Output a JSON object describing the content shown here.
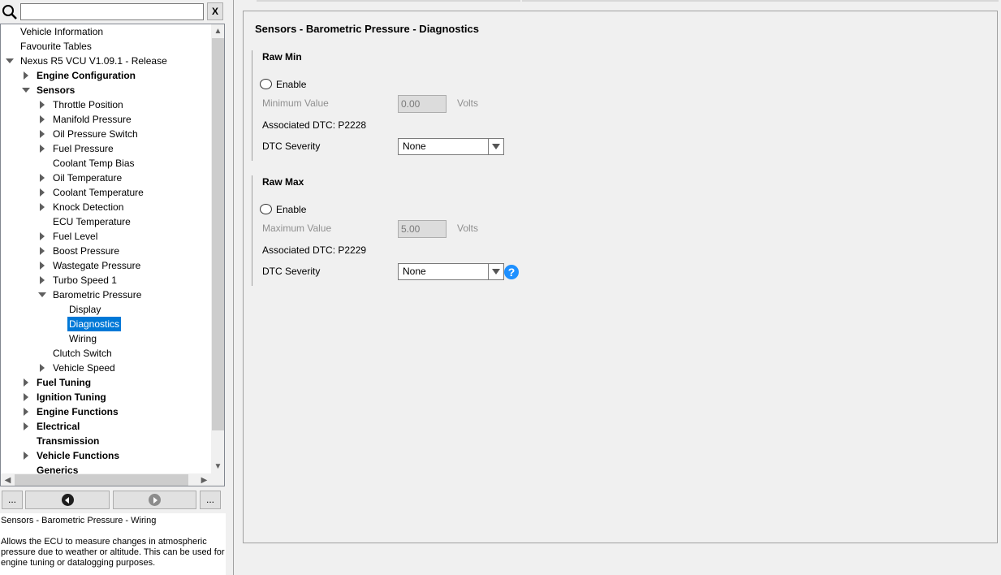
{
  "search": {
    "placeholder": "",
    "value": "",
    "clear_label": "X"
  },
  "tree": {
    "items": [
      {
        "label": "Vehicle Information",
        "level": 0,
        "expander": "none",
        "bold": false
      },
      {
        "label": "Favourite Tables",
        "level": 0,
        "expander": "none",
        "bold": false
      },
      {
        "label": "Nexus R5 VCU V1.09.1 - Release",
        "level": 0,
        "expander": "down",
        "bold": false
      },
      {
        "label": "Engine Configuration",
        "level": 1,
        "expander": "right",
        "bold": true
      },
      {
        "label": "Sensors",
        "level": 1,
        "expander": "down",
        "bold": true
      },
      {
        "label": "Throttle Position",
        "level": 2,
        "expander": "right",
        "bold": false
      },
      {
        "label": "Manifold Pressure",
        "level": 2,
        "expander": "right",
        "bold": false
      },
      {
        "label": "Oil Pressure Switch",
        "level": 2,
        "expander": "right",
        "bold": false
      },
      {
        "label": "Fuel Pressure",
        "level": 2,
        "expander": "right",
        "bold": false
      },
      {
        "label": "Coolant Temp Bias",
        "level": 2,
        "expander": "none",
        "bold": false
      },
      {
        "label": "Oil Temperature",
        "level": 2,
        "expander": "right",
        "bold": false
      },
      {
        "label": "Coolant Temperature",
        "level": 2,
        "expander": "right",
        "bold": false
      },
      {
        "label": "Knock Detection",
        "level": 2,
        "expander": "right",
        "bold": false
      },
      {
        "label": "ECU Temperature",
        "level": 2,
        "expander": "none",
        "bold": false
      },
      {
        "label": "Fuel Level",
        "level": 2,
        "expander": "right",
        "bold": false
      },
      {
        "label": "Boost Pressure",
        "level": 2,
        "expander": "right",
        "bold": false
      },
      {
        "label": "Wastegate Pressure",
        "level": 2,
        "expander": "right",
        "bold": false
      },
      {
        "label": "Turbo Speed 1",
        "level": 2,
        "expander": "right",
        "bold": false
      },
      {
        "label": "Barometric Pressure",
        "level": 2,
        "expander": "down",
        "bold": false
      },
      {
        "label": "Display",
        "level": 3,
        "expander": "none",
        "bold": false
      },
      {
        "label": "Diagnostics",
        "level": 3,
        "expander": "none",
        "bold": false,
        "selected": true
      },
      {
        "label": "Wiring",
        "level": 3,
        "expander": "none",
        "bold": false
      },
      {
        "label": "Clutch Switch",
        "level": 2,
        "expander": "none",
        "bold": false
      },
      {
        "label": "Vehicle Speed",
        "level": 2,
        "expander": "right",
        "bold": false
      },
      {
        "label": "Fuel Tuning",
        "level": 1,
        "expander": "right",
        "bold": true
      },
      {
        "label": "Ignition Tuning",
        "level": 1,
        "expander": "right",
        "bold": true
      },
      {
        "label": "Engine Functions",
        "level": 1,
        "expander": "right",
        "bold": true
      },
      {
        "label": "Electrical",
        "level": 1,
        "expander": "right",
        "bold": true
      },
      {
        "label": "Transmission",
        "level": 1,
        "expander": "none",
        "bold": true
      },
      {
        "label": "Vehicle Functions",
        "level": 1,
        "expander": "right",
        "bold": true
      },
      {
        "label": "Generics",
        "level": 1,
        "expander": "none",
        "bold": true
      }
    ]
  },
  "nav": {
    "left_more": "...",
    "right_more": "..."
  },
  "help": {
    "title": "Sensors - Barometric Pressure - Wiring",
    "body": "Allows the ECU to measure changes in atmospheric pressure due to weather or altitude. This can be used for engine tuning or datalogging purposes."
  },
  "page": {
    "title": "Sensors - Barometric Pressure - Diagnostics",
    "raw_min": {
      "title": "Raw Min",
      "enable_label": "Enable",
      "value_label": "Minimum Value",
      "value": "0.00",
      "unit": "Volts",
      "dtc_label": "Associated DTC: P2228",
      "severity_label": "DTC Severity",
      "severity_value": "None"
    },
    "raw_max": {
      "title": "Raw Max",
      "enable_label": "Enable",
      "value_label": "Maximum Value",
      "value": "5.00",
      "unit": "Volts",
      "dtc_label": "Associated DTC: P2229",
      "severity_label": "DTC Severity",
      "severity_value": "None"
    },
    "help_icon_glyph": "?"
  },
  "colors": {
    "selection": "#0078d7",
    "help_icon": "#1e90ff"
  }
}
